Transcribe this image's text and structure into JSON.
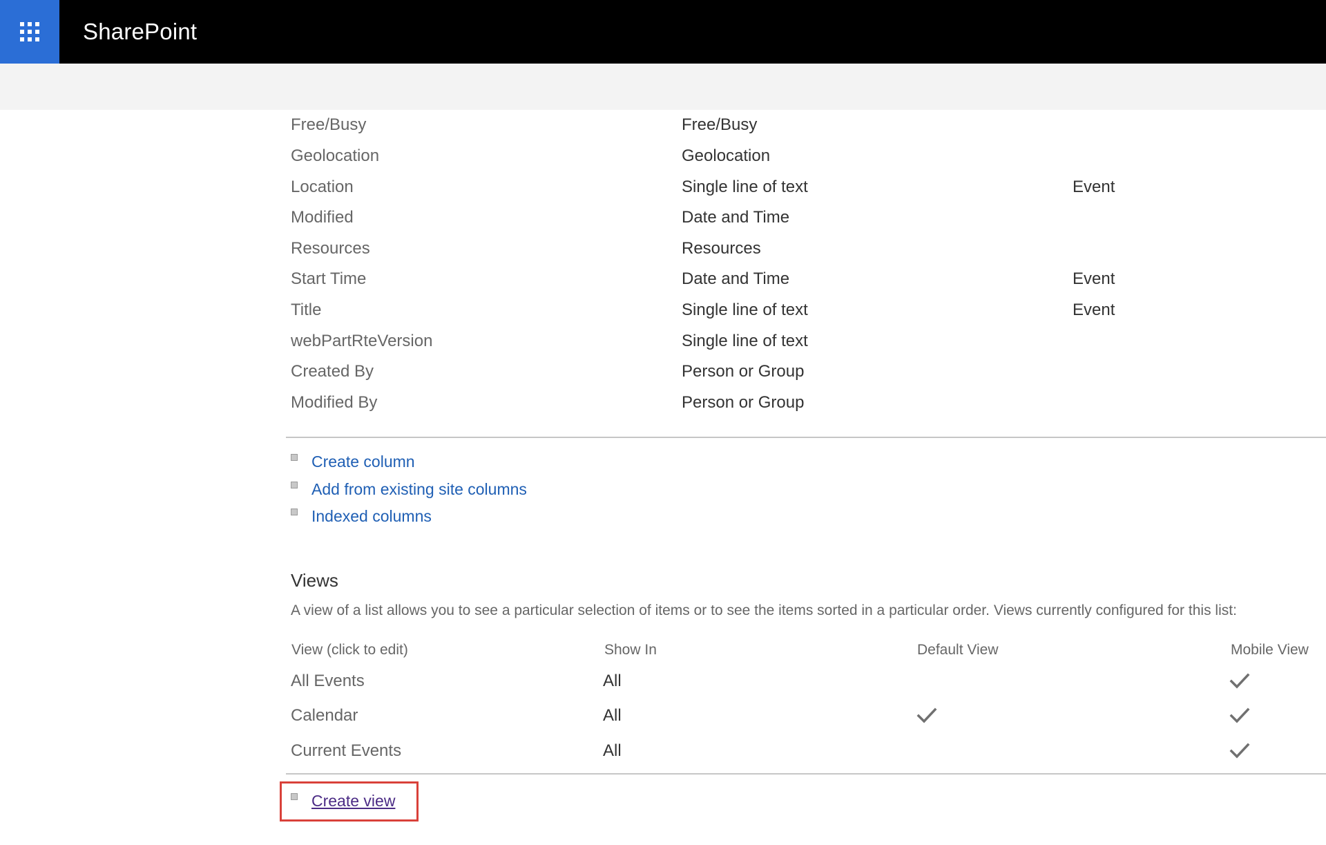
{
  "suitebar": {
    "app_name": "SharePoint"
  },
  "columns": [
    {
      "name": "Free/Busy",
      "type": "Free/Busy",
      "used_in": ""
    },
    {
      "name": "Geolocation",
      "type": "Geolocation",
      "used_in": ""
    },
    {
      "name": "Location",
      "type": "Single line of text",
      "used_in": "Event"
    },
    {
      "name": "Modified",
      "type": "Date and Time",
      "used_in": ""
    },
    {
      "name": "Resources",
      "type": "Resources",
      "used_in": ""
    },
    {
      "name": "Start Time",
      "type": "Date and Time",
      "used_in": "Event"
    },
    {
      "name": "Title",
      "type": "Single line of text",
      "used_in": "Event"
    },
    {
      "name": "webPartRteVersion",
      "type": "Single line of text",
      "used_in": ""
    },
    {
      "name": "Created By",
      "type": "Person or Group",
      "used_in": ""
    },
    {
      "name": "Modified By",
      "type": "Person or Group",
      "used_in": ""
    }
  ],
  "column_links": {
    "create_column": "Create column",
    "add_existing": "Add from existing site columns",
    "indexed": "Indexed columns"
  },
  "views": {
    "heading": "Views",
    "description": "A view of a list allows you to see a particular selection of items or to see the items sorted in a particular order. Views currently configured for this list:",
    "headers": {
      "view": "View (click to edit)",
      "show_in": "Show In",
      "default_view": "Default View",
      "mobile_view": "Mobile View"
    },
    "rows": [
      {
        "name": "All Events",
        "show_in": "All",
        "default": false,
        "mobile": true
      },
      {
        "name": "Calendar",
        "show_in": "All",
        "default": true,
        "mobile": true
      },
      {
        "name": "Current Events",
        "show_in": "All",
        "default": false,
        "mobile": true
      }
    ],
    "create_view": "Create view"
  },
  "icons": {
    "waffle": "app-launcher-icon",
    "check": "checkmark-icon",
    "bullet": "bullet-square-icon"
  },
  "colors": {
    "suitebar_bg": "#000000",
    "waffle_bg": "#2b6ed6",
    "link": "#1f5fb4",
    "visited_link": "#4b2b85",
    "highlight_box": "#d9413a"
  }
}
